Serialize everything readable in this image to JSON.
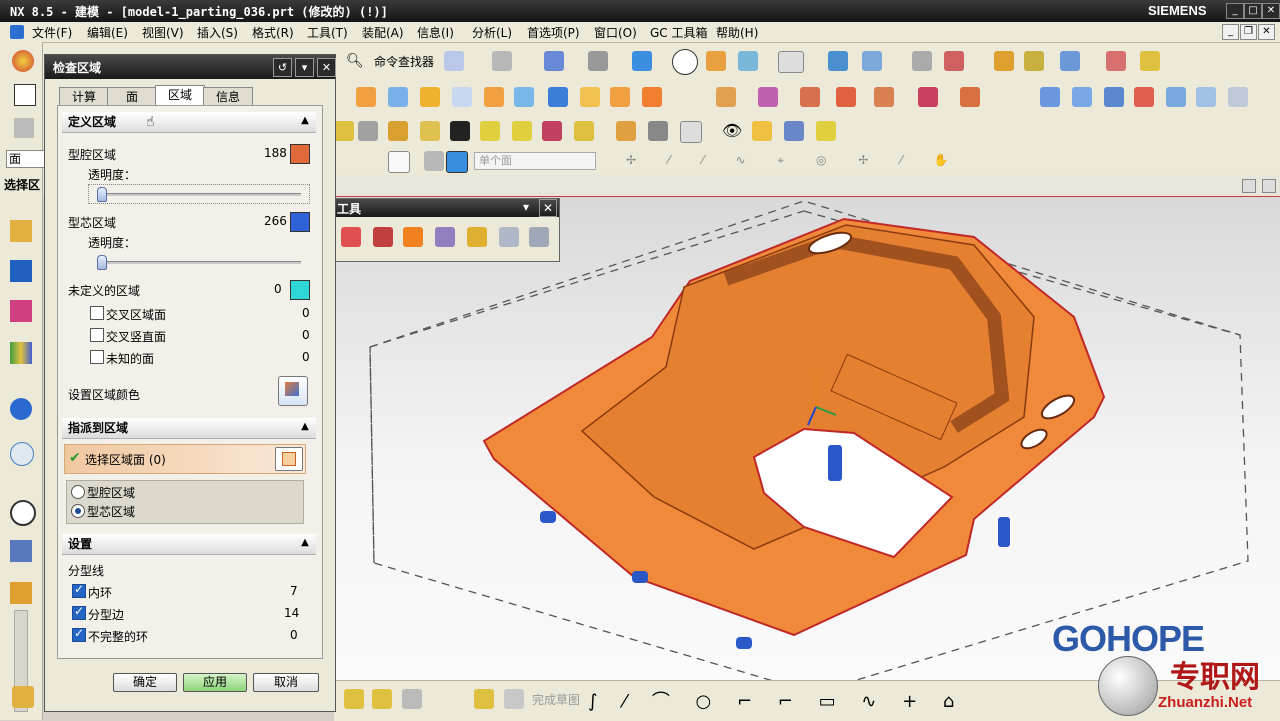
{
  "titlebar": {
    "title": "NX 8.5 - 建模 - [model-1_parting_036.prt (修改的) (!)]",
    "brand": "SIEMENS"
  },
  "menu": [
    "文件(F)",
    "编辑(E)",
    "视图(V)",
    "插入(S)",
    "格式(R)",
    "工具(T)",
    "装配(A)",
    "信息(I)",
    "分析(L)",
    "首选项(P)",
    "窗口(O)",
    "GC 工具箱",
    "帮助(H)"
  ],
  "toolbar": {
    "command_finder": "命令查找器",
    "filter_value": "单个面",
    "finish_sketch": "完成草图"
  },
  "left": {
    "face_field": "面",
    "select_region": "选择区"
  },
  "palette": {
    "title": "工具"
  },
  "dialog": {
    "title": "检查区域",
    "tabs": [
      "计算",
      "面",
      "区域",
      "信息"
    ],
    "active_tab": "区域",
    "define_section": "定义区域",
    "cavity_label": "型腔区域",
    "cavity_count": "188",
    "cavity_color": "#e06a3a",
    "transparency_label": "透明度：",
    "core_label": "型芯区域",
    "core_count": "266",
    "core_color": "#2f61d6",
    "undefined_label": "未定义的区域",
    "undefined_count": "0",
    "undefined_color": "#2fd6d6",
    "undefined_options": [
      {
        "label": "交叉区域面",
        "count": "0"
      },
      {
        "label": "交叉竖直面",
        "count": "0"
      },
      {
        "label": "未知的面",
        "count": "0"
      }
    ],
    "set_color_label": "设置区域颜色",
    "assign_section": "指派到区域",
    "select_faces_label": "选择区域面 (0)",
    "assign_options": [
      "型腔区域",
      "型芯区域"
    ],
    "assign_selected": "型芯区域",
    "settings_section": "设置",
    "parting_label": "分型线",
    "settings_options": [
      {
        "label": "内环",
        "count": "7",
        "checked": true
      },
      {
        "label": "分型边",
        "count": "14",
        "checked": true
      },
      {
        "label": "不完整的环",
        "count": "0",
        "checked": true
      }
    ],
    "ok": "确定",
    "apply": "应用",
    "cancel": "取消"
  },
  "watermarks": {
    "logo": "GOHOPE",
    "cn": "专职网",
    "site": "Zhuanzhi.Net"
  }
}
